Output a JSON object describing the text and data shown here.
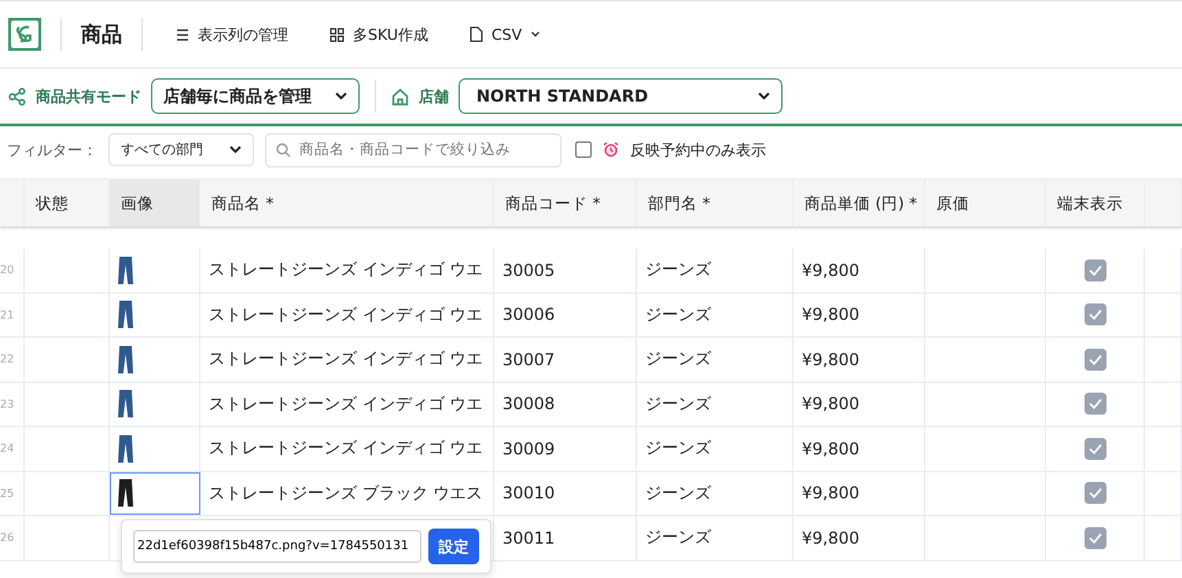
{
  "header": {
    "title": "商品",
    "actions": [
      {
        "kind": "columns",
        "label": "表示列の管理"
      },
      {
        "kind": "grid",
        "label": "多SKU作成"
      },
      {
        "kind": "file",
        "label": "CSV"
      }
    ]
  },
  "mode_bar": {
    "share_label": "商品共有モード",
    "share_value": "店舗毎に商品を管理",
    "store_label": "店舗",
    "store_value": "NORTH STANDARD"
  },
  "filter": {
    "label": "フィルター：",
    "department": "すべての部門",
    "search_placeholder": "商品名・商品コードで絞り込み",
    "reserved_only": {
      "label": "反映予約中のみ表示",
      "checked": false
    }
  },
  "table": {
    "columns": [
      "状態",
      "画像",
      "商品名 *",
      "商品コード *",
      "部門名 *",
      "商品単価 (円) *",
      "原価",
      "端末表示"
    ],
    "rows": [
      {
        "num": "20",
        "color": "#2f5a8f",
        "name": "ストレートジーンズ インディゴ ウエ",
        "code": "30005",
        "dept": "ジーンズ",
        "price": "¥9,800",
        "terminal": true,
        "selected": false
      },
      {
        "num": "21",
        "color": "#2f5a8f",
        "name": "ストレートジーンズ インディゴ ウエ",
        "code": "30006",
        "dept": "ジーンズ",
        "price": "¥9,800",
        "terminal": true,
        "selected": false
      },
      {
        "num": "22",
        "color": "#2f5a8f",
        "name": "ストレートジーンズ インディゴ ウエ",
        "code": "30007",
        "dept": "ジーンズ",
        "price": "¥9,800",
        "terminal": true,
        "selected": false
      },
      {
        "num": "23",
        "color": "#2f5a8f",
        "name": "ストレートジーンズ インディゴ ウエ",
        "code": "30008",
        "dept": "ジーンズ",
        "price": "¥9,800",
        "terminal": true,
        "selected": false
      },
      {
        "num": "24",
        "color": "#2f5a8f",
        "name": "ストレートジーンズ インディゴ ウエ",
        "code": "30009",
        "dept": "ジーンズ",
        "price": "¥9,800",
        "terminal": true,
        "selected": false
      },
      {
        "num": "25",
        "color": "#1e1e1e",
        "name": "ストレートジーンズ ブラック ウエス",
        "code": "30010",
        "dept": "ジーンズ",
        "price": "¥9,800",
        "terminal": true,
        "selected": true
      },
      {
        "num": "26",
        "code": "30011",
        "dept": "ジーンズ",
        "price": "¥9,800",
        "terminal": true,
        "selected": false
      }
    ]
  },
  "image_popover": {
    "url": "22d1ef60398f15b487c.png?v=1784550131",
    "button": "設定"
  }
}
